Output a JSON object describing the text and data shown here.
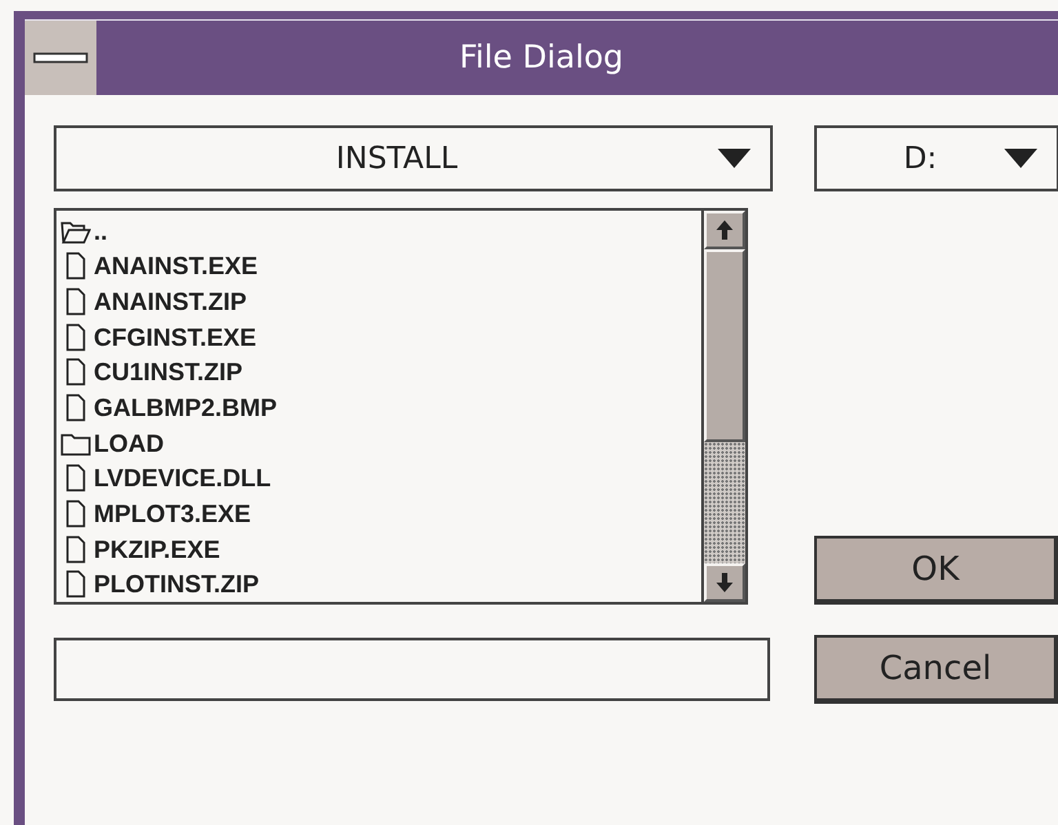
{
  "window": {
    "title": "File Dialog"
  },
  "directory": {
    "value": "INSTALL"
  },
  "drive": {
    "value": "D:"
  },
  "files": [
    {
      "name": "..",
      "kind": "parent"
    },
    {
      "name": "ANAINST.EXE",
      "kind": "file"
    },
    {
      "name": "ANAINST.ZIP",
      "kind": "file"
    },
    {
      "name": "CFGINST.EXE",
      "kind": "file"
    },
    {
      "name": "CU1INST.ZIP",
      "kind": "file"
    },
    {
      "name": "GALBMP2.BMP",
      "kind": "file"
    },
    {
      "name": "LOAD",
      "kind": "folder"
    },
    {
      "name": "LVDEVICE.DLL",
      "kind": "file"
    },
    {
      "name": "MPLOT3.EXE",
      "kind": "file"
    },
    {
      "name": "PKZIP.EXE",
      "kind": "file"
    },
    {
      "name": "PLOTINST.ZIP",
      "kind": "file"
    }
  ],
  "buttons": [
    {
      "label": "OK"
    },
    {
      "label": "Cancel"
    }
  ]
}
